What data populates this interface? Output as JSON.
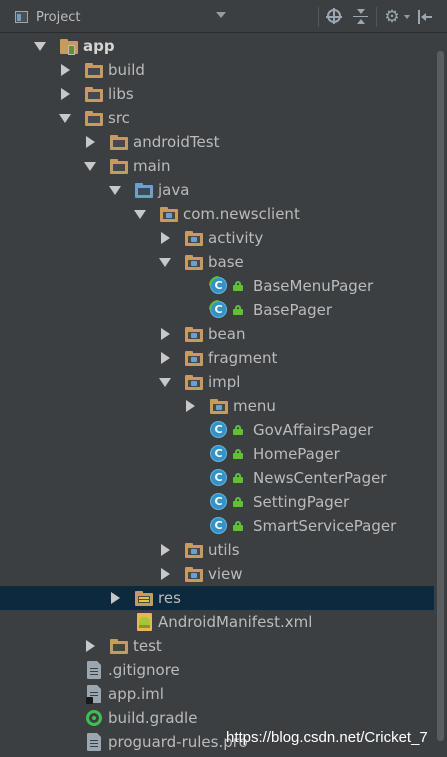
{
  "toolbar": {
    "view_title": "Project"
  },
  "tree": {
    "app": "app",
    "build": "build",
    "libs": "libs",
    "src": "src",
    "androidTest": "androidTest",
    "main": "main",
    "java": "java",
    "package": "com.newsclient",
    "activity": "activity",
    "base": "base",
    "base_menu_pager": "BaseMenuPager",
    "base_pager": "BasePager",
    "bean": "bean",
    "fragment": "fragment",
    "impl": "impl",
    "menu": "menu",
    "gov_affairs_pager": "GovAffairsPager",
    "home_pager": "HomePager",
    "news_center_pager": "NewsCenterPager",
    "setting_pager": "SettingPager",
    "smart_service_pager": "SmartServicePager",
    "utils": "utils",
    "view": "view",
    "res": "res",
    "manifest": "AndroidManifest.xml",
    "test": "test",
    "gitignore": ".gitignore",
    "app_iml": "app.iml",
    "build_gradle": "build.gradle",
    "proguard": "proguard-rules.pro",
    "class_letter": "C"
  },
  "watermark": "https://blog.csdn.net/Cricket_7"
}
